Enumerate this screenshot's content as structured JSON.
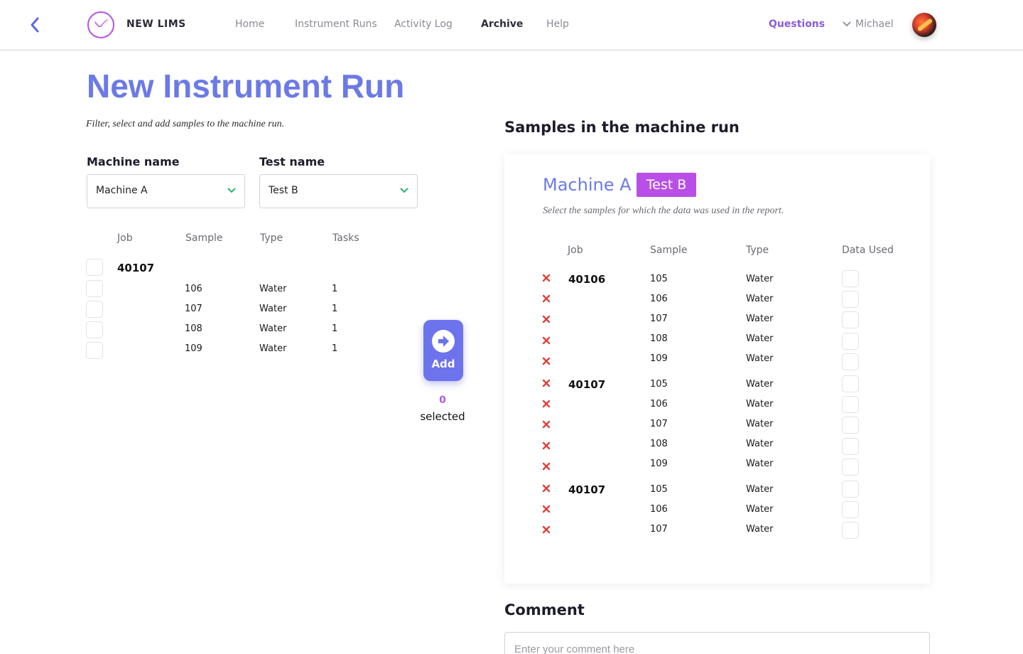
{
  "header": {
    "app_name": "NEW LIMS",
    "nav": [
      {
        "label": "Home",
        "active": false
      },
      {
        "label": "Instrument Runs",
        "active": false
      },
      {
        "label": "Activity Log",
        "active": false
      },
      {
        "label": "Archive",
        "active": true
      },
      {
        "label": "Help",
        "active": false
      }
    ],
    "questions_label": "Questions",
    "user_name": "Michael",
    "icons": {
      "back": "chevron-left-icon",
      "logo": "clock-logo-icon",
      "user_menu": "chevron-down-icon"
    }
  },
  "page": {
    "title": "New Instrument Run",
    "subtitle": "Filter, select and add samples to the machine run."
  },
  "filters": {
    "machine_label": "Machine name",
    "machine_value": "Machine A",
    "test_label": "Test name",
    "test_value": "Test B"
  },
  "available": {
    "columns": [
      "Job",
      "Sample",
      "Type",
      "Tasks"
    ],
    "job": "40107",
    "rows": [
      {
        "sample": "106",
        "type": "Water",
        "tasks": "1"
      },
      {
        "sample": "107",
        "type": "Water",
        "tasks": "1"
      },
      {
        "sample": "108",
        "type": "Water",
        "tasks": "1"
      },
      {
        "sample": "109",
        "type": "Water",
        "tasks": "1"
      }
    ]
  },
  "add": {
    "label": "Add",
    "count": "0",
    "selected_label": "selected"
  },
  "run": {
    "title": "Samples in the machine run",
    "machine": "Machine A",
    "test": "Test B",
    "subtitle": "Select the samples for which the data was used in the report.",
    "columns": [
      "Job",
      "Sample",
      "Type",
      "Data Used"
    ],
    "groups": [
      {
        "job": "40106",
        "rows": [
          {
            "sample": "105",
            "type": "Water"
          },
          {
            "sample": "106",
            "type": "Water"
          },
          {
            "sample": "107",
            "type": "Water"
          },
          {
            "sample": "108",
            "type": "Water"
          },
          {
            "sample": "109",
            "type": "Water"
          }
        ]
      },
      {
        "job": "40107",
        "rows": [
          {
            "sample": "105",
            "type": "Water"
          },
          {
            "sample": "106",
            "type": "Water"
          },
          {
            "sample": "107",
            "type": "Water"
          },
          {
            "sample": "108",
            "type": "Water"
          },
          {
            "sample": "109",
            "type": "Water"
          }
        ]
      },
      {
        "job": "40107",
        "rows": [
          {
            "sample": "105",
            "type": "Water"
          },
          {
            "sample": "106",
            "type": "Water"
          },
          {
            "sample": "107",
            "type": "Water"
          }
        ]
      }
    ]
  },
  "comment": {
    "title": "Comment",
    "placeholder": "Enter your comment here"
  },
  "colors": {
    "accent": "#6b7ae6",
    "badge": "#b94fe6",
    "questions": "#8b5cd6",
    "remove": "#e0403c",
    "check": "#2bb36b"
  }
}
